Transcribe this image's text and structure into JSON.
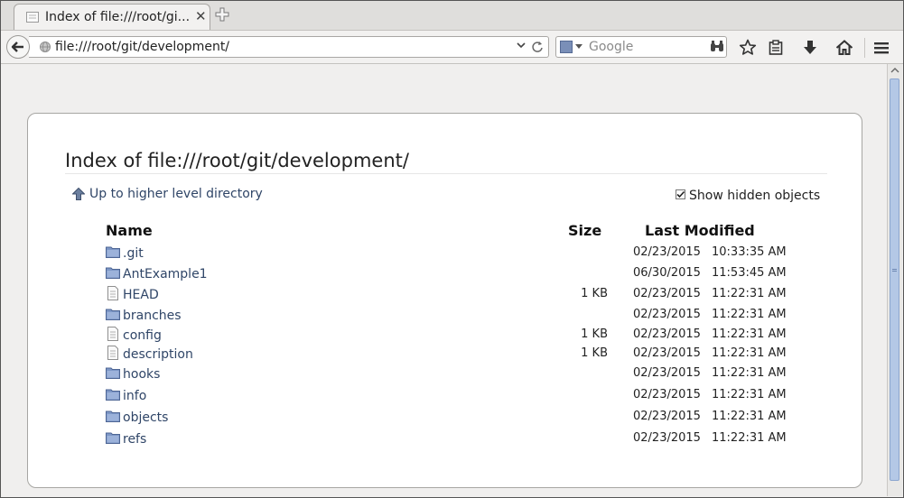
{
  "browser": {
    "tab_title": "Index of file:///root/gi...",
    "url": "file:///root/git/development/",
    "search_placeholder": "Google"
  },
  "page": {
    "title": "Index of file:///root/git/development/",
    "up_link": "Up to higher level directory",
    "show_hidden_label": "Show hidden objects",
    "show_hidden_checked": true,
    "columns": {
      "name": "Name",
      "size": "Size",
      "modified": "Last Modified"
    },
    "rows": [
      {
        "name": ".git",
        "type": "folder",
        "size": "",
        "date": "02/23/2015",
        "time": "10:33:35 AM"
      },
      {
        "name": "AntExample1",
        "type": "folder",
        "size": "",
        "date": "06/30/2015",
        "time": "11:53:45 AM"
      },
      {
        "name": "HEAD",
        "type": "file",
        "size": "1 KB",
        "date": "02/23/2015",
        "time": "11:22:31 AM"
      },
      {
        "name": "branches",
        "type": "folder",
        "size": "",
        "date": "02/23/2015",
        "time": "11:22:31 AM"
      },
      {
        "name": "config",
        "type": "file",
        "size": "1 KB",
        "date": "02/23/2015",
        "time": "11:22:31 AM"
      },
      {
        "name": "description",
        "type": "file",
        "size": "1 KB",
        "date": "02/23/2015",
        "time": "11:22:31 AM"
      },
      {
        "name": "hooks",
        "type": "folder",
        "size": "",
        "date": "02/23/2015",
        "time": "11:22:31 AM"
      },
      {
        "name": "info",
        "type": "folder",
        "size": "",
        "date": "02/23/2015",
        "time": "11:22:31 AM"
      },
      {
        "name": "objects",
        "type": "folder",
        "size": "",
        "date": "02/23/2015",
        "time": "11:22:31 AM"
      },
      {
        "name": "refs",
        "type": "folder",
        "size": "",
        "date": "02/23/2015",
        "time": "11:22:31 AM"
      }
    ]
  },
  "icons": {
    "tab": "page-icon",
    "new_tab": "plus-icon",
    "back": "back-arrow-icon",
    "site": "globe-icon",
    "url_history": "chevron-down-icon",
    "reload": "reload-icon",
    "search_engine": "search-engine-icon",
    "search_go": "binoculars-icon",
    "bookmark": "star-icon",
    "bookmarks_menu": "clipboard-icon",
    "downloads": "download-arrow-icon",
    "home": "home-icon",
    "menu": "hamburger-icon",
    "up_directory": "up-arrow-icon",
    "folder": "folder-icon",
    "file": "file-icon"
  },
  "colors": {
    "link": "#2f4567",
    "folder": "#7d97c6",
    "scroll_thumb": "#b4c8e6",
    "window_bg": "#f0efee"
  }
}
